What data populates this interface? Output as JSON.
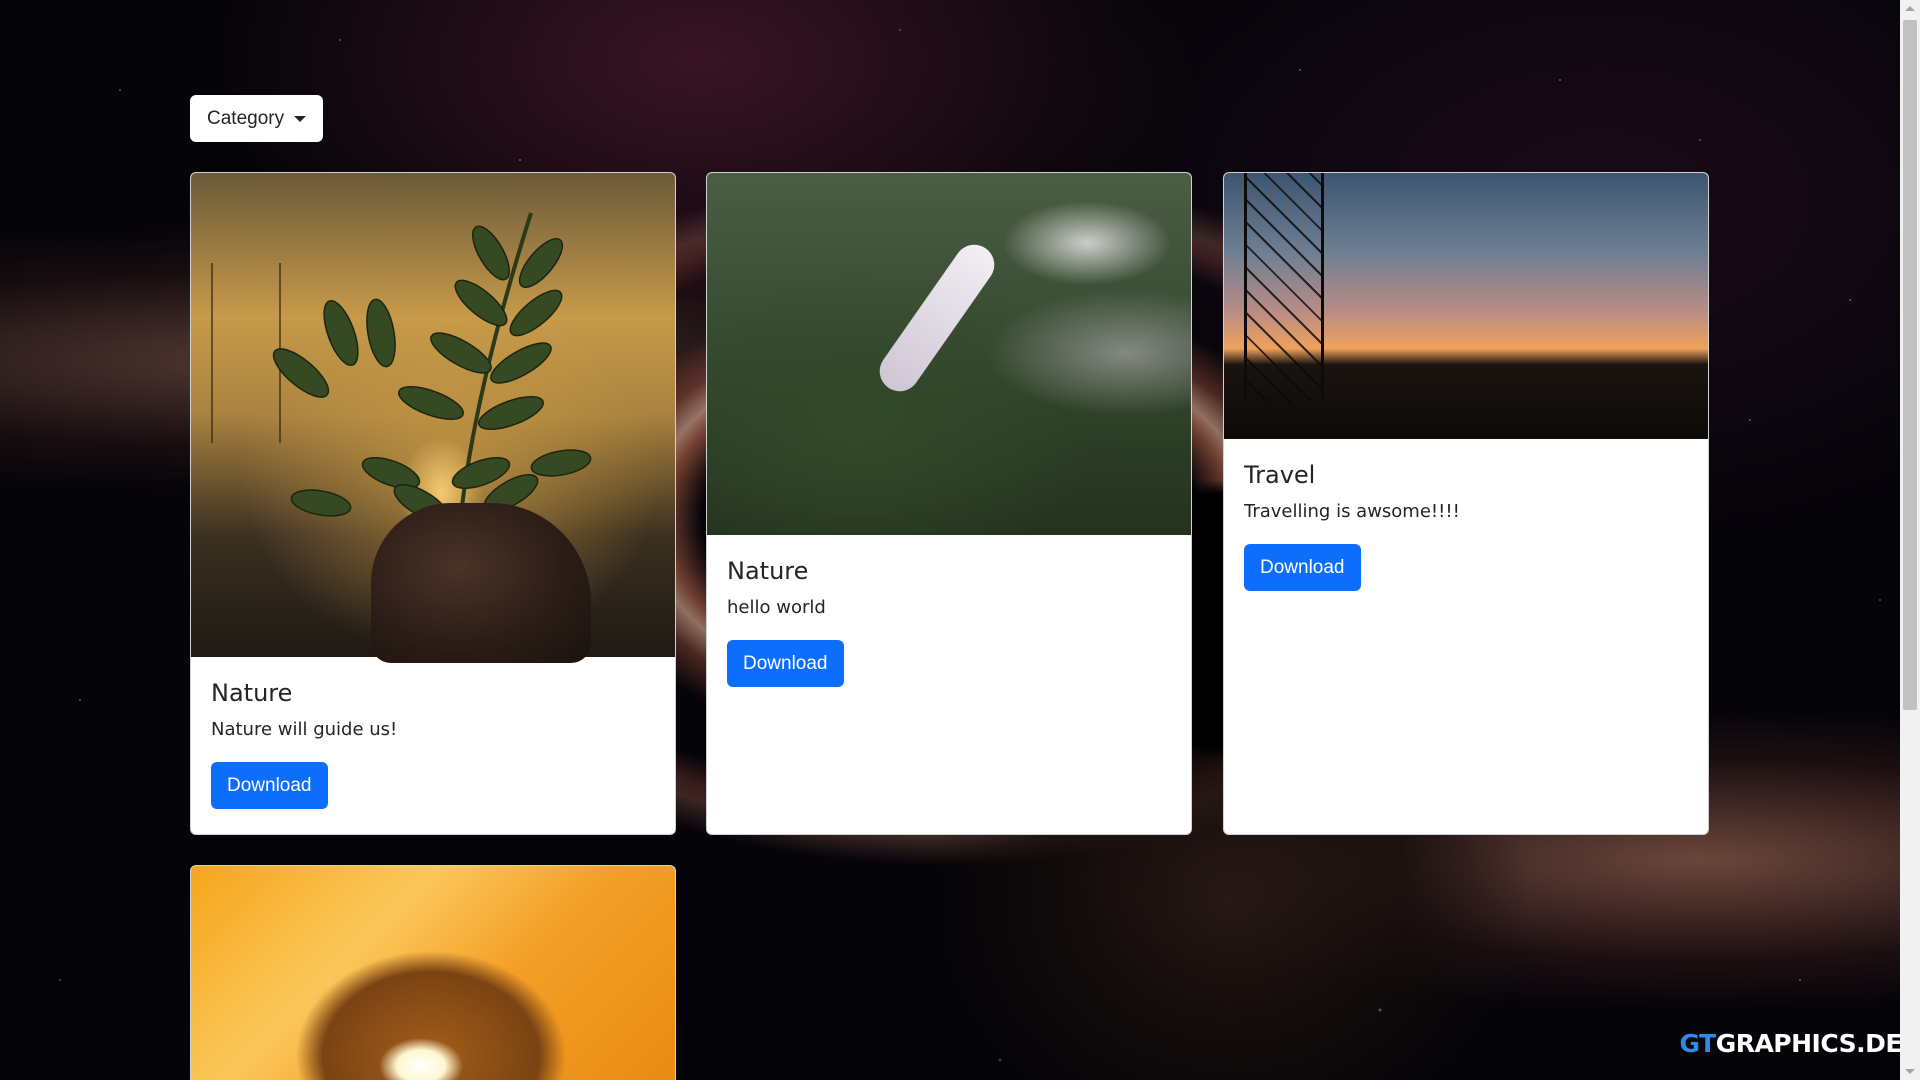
{
  "filter": {
    "label": "Category"
  },
  "cards": [
    {
      "title": "Nature",
      "text": "Nature will guide us!",
      "button": "Download"
    },
    {
      "title": "Nature",
      "text": "hello world",
      "button": "Download"
    },
    {
      "title": "Travel",
      "text": "Travelling is awsome!!!!",
      "button": "Download"
    },
    {
      "title": "",
      "text": "",
      "button": ""
    }
  ],
  "watermark": {
    "brand_prefix": "GT",
    "brand_suffix": "GRAPHICS.DE"
  },
  "colors": {
    "primary": "#0d6efd",
    "watermark_accent": "#2c8be8"
  },
  "icons": {
    "dropdown": "caret-down-icon"
  }
}
